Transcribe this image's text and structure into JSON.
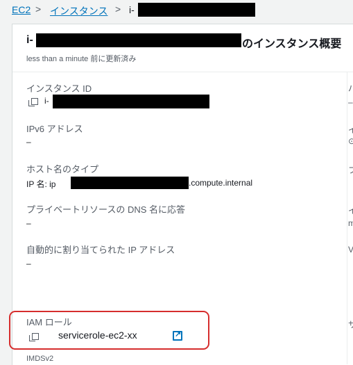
{
  "breadcrumb": {
    "root": "EC2",
    "section": "インスタンス",
    "current_prefix": "i-"
  },
  "panel": {
    "title_prefix": "i-",
    "title_suffix": "のインスタンス概要",
    "updated": "less than a minute 前に更新済み"
  },
  "fields": {
    "instance_id_label": "インスタンス ID",
    "instance_id_prefix": "i-",
    "ipv6_label": "IPv6 アドレス",
    "ipv6_value": "–",
    "hostname_type_label": "ホスト名のタイプ",
    "hostname_type_prefix": "IP 名: ip",
    "hostname_type_suffix": ".compute.internal",
    "dns_label": "プライベートリソースの DNS 名に応答",
    "dns_value": "–",
    "auto_ip_label": "自動的に割り当てられた IP アドレス",
    "auto_ip_value": "–",
    "iam_label": "IAM ロール",
    "iam_value": "servicerole-ec2-xx",
    "imds_label": "IMDSv2"
  },
  "colors": {
    "link": "#0073bb",
    "highlight": "#d62d2d"
  }
}
